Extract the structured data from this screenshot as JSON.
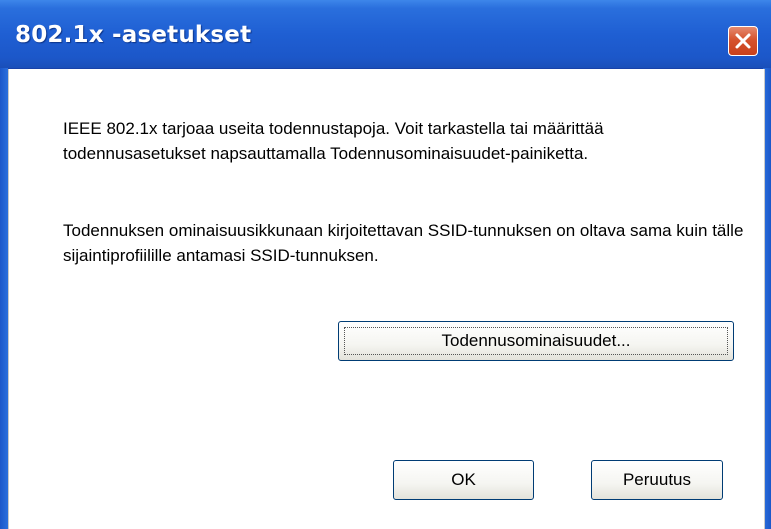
{
  "window": {
    "title": "802.1x -asetukset"
  },
  "body": {
    "paragraph1": "IEEE 802.1x tarjoaa useita todennustapoja. Voit tarkastella tai määrittää todennusasetukset napsauttamalla Todennusominaisuudet-painiketta.",
    "paragraph2": "Todennuksen ominaisuusikkunaan kirjoitettavan SSID-tunnuksen on oltava sama kuin tälle sijaintiprofiilille antamasi SSID-tunnuksen."
  },
  "buttons": {
    "properties_label": "Todennusominaisuudet...",
    "ok_label": "OK",
    "cancel_label": "Peruutus"
  },
  "icons": {
    "close": "close-icon"
  },
  "colors": {
    "titlebar": "#1f5fd3",
    "close_button": "#d6532e",
    "button_border": "#003c74"
  }
}
